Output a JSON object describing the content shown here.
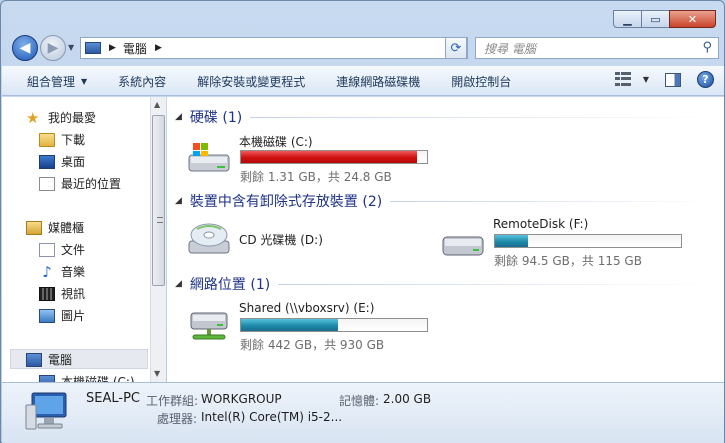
{
  "address": {
    "location": "電腦"
  },
  "search": {
    "placeholder": "搜尋 電腦"
  },
  "toolbar": {
    "organize": "組合管理",
    "system_properties": "系統內容",
    "uninstall": "解除安裝或變更程式",
    "map_drive": "連線網路磁碟機",
    "control_panel": "開啟控制台"
  },
  "sidebar": {
    "favorites": "我的最愛",
    "downloads": "下載",
    "desktop": "桌面",
    "recent": "最近的位置",
    "libraries": "媒體櫃",
    "documents": "文件",
    "music": "音樂",
    "videos": "視訊",
    "pictures": "圖片",
    "computer": "電腦",
    "local_disk": "本機磁碟 (C:)"
  },
  "groups": {
    "hard_disks": "硬碟 (1)",
    "removable": "裝置中含有卸除式存放裝置 (2)",
    "network": "網路位置 (1)"
  },
  "drives": [
    {
      "name": "本機磁碟 (C:)",
      "free": "剩餘 1.31 GB，共 24.8 GB",
      "used_fraction": 0.947,
      "color": "#d01010"
    },
    {
      "name": "CD 光碟機 (D:)"
    },
    {
      "name": "RemoteDisk (F:)",
      "free": "剩餘 94.5 GB，共 115 GB",
      "used_fraction": 0.18,
      "color": "#1e8aaa"
    },
    {
      "name": "Shared (\\\\vboxsrv) (E:)",
      "free": "剩餘 442 GB，共 930 GB",
      "used_fraction": 0.52,
      "color": "#1e8aaa"
    }
  ],
  "status": {
    "computer_name": "SEAL-PC",
    "workgroup_label": "工作群組:",
    "workgroup": "WORKGROUP",
    "memory_label": "記憶體:",
    "memory": "2.00 GB",
    "processor_label": "處理器:",
    "processor": "Intel(R) Core(TM) i5-2..."
  }
}
